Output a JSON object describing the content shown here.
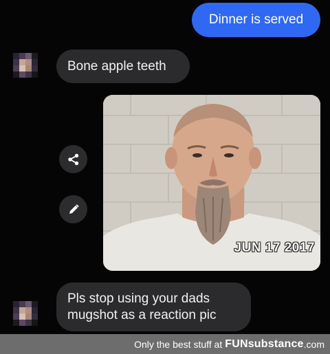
{
  "conversation": {
    "messages": [
      {
        "type": "sent",
        "text": "Dinner is served"
      },
      {
        "type": "received",
        "text": "Bone apple teeth"
      },
      {
        "type": "received_image",
        "stamp": "JUN 17 2017"
      },
      {
        "type": "received",
        "text": "Pls stop using your dads mugshot as a reaction pic"
      }
    ],
    "actions": [
      {
        "icon": "share-icon"
      },
      {
        "icon": "edit-pencil-icon"
      }
    ]
  },
  "footer": {
    "tagline": "Only the best stuff at",
    "brand": "FUNsubstance",
    "domain": ".com"
  },
  "colors": {
    "background": "#050505",
    "sent_bubble": "#2f68f2",
    "received_bubble": "#2b2b2d",
    "footer_bar": "#6d6d6d"
  }
}
